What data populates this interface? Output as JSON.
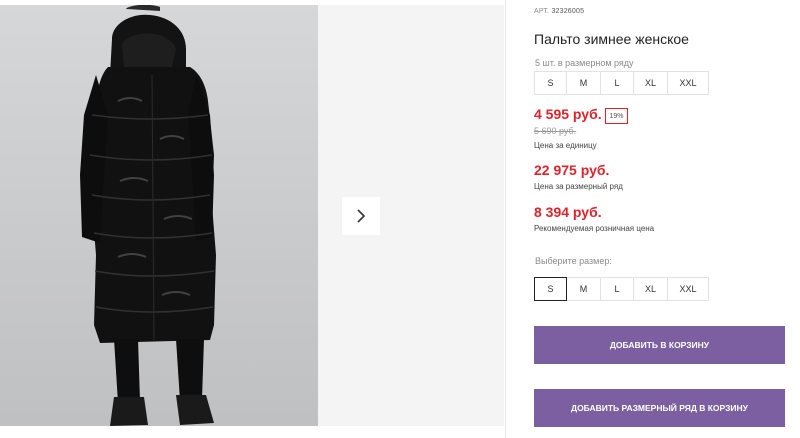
{
  "product": {
    "article_label": "АРТ.",
    "article_number": "32326005",
    "title": "Пальто зимнее женское"
  },
  "size_run": {
    "hint": "5 шт. в размерном ряду",
    "sizes": [
      "S",
      "M",
      "L",
      "XL",
      "XXL"
    ]
  },
  "prices": {
    "unit_price": "4 595 руб.",
    "discount_badge": "19%",
    "old_price": "5 690 руб.",
    "unit_caption": "Цена за единицу",
    "run_price": "22 975 руб.",
    "run_caption": "Цена за размерный ряд",
    "retail_price": "8 394 руб.",
    "retail_caption": "Рекомендуемая розничная цена"
  },
  "size_select": {
    "label": "Выберите размер:",
    "sizes": [
      "S",
      "M",
      "L",
      "XL",
      "XXL"
    ],
    "selected": "S"
  },
  "actions": {
    "add_to_cart": "ДОБАВИТЬ В КОРЗИНУ",
    "add_run_to_cart": "ДОБАВИТЬ РАЗМЕРНЫЙ РЯД В КОРЗИНУ"
  },
  "gallery": {
    "next_icon": "chevron-right-icon"
  },
  "colors": {
    "accent": "#7b5fa0",
    "price": "#e0232b",
    "coat": "#151515"
  }
}
